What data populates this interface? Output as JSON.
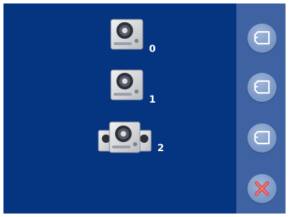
{
  "background_color": "#053480",
  "side_panel_color": "#3f63a2",
  "door_stations": [
    {
      "label": "0",
      "icon": "single-door-station-icon"
    },
    {
      "label": "1",
      "icon": "single-door-station-icon"
    },
    {
      "label": "2",
      "icon": "multi-door-station-icon"
    }
  ],
  "side_buttons": [
    {
      "icon": "camera-icon"
    },
    {
      "icon": "camera-icon"
    },
    {
      "icon": "camera-icon"
    },
    {
      "icon": "close-icon",
      "accent": "#e05050"
    }
  ]
}
